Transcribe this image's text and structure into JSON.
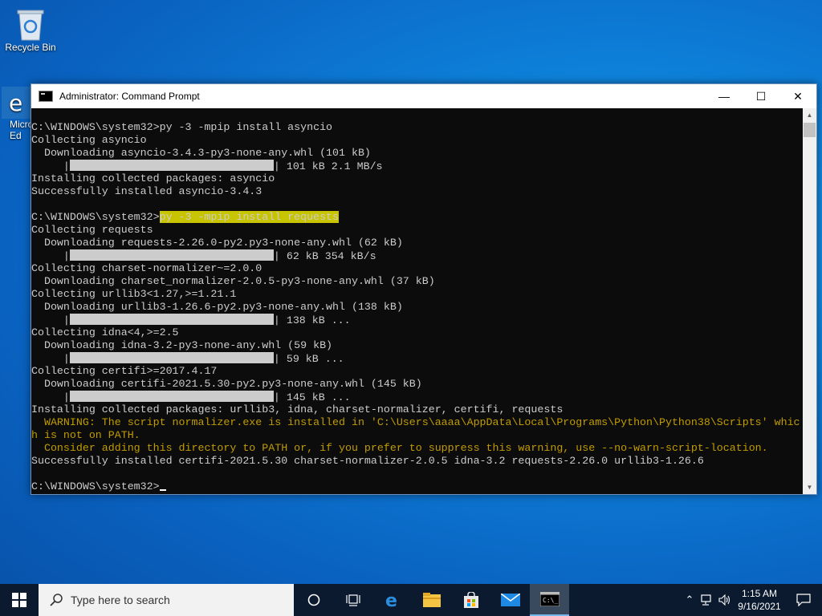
{
  "desktop": {
    "icons": [
      {
        "label": "Recycle Bin"
      },
      {
        "label": "Micro Ed"
      }
    ]
  },
  "window": {
    "title": "Administrator: Command Prompt",
    "buttons": {
      "minimize": "—",
      "maximize": "☐",
      "close": "✕"
    }
  },
  "console": {
    "lines": [
      {
        "text": "C:\\WINDOWS\\system32>py -3 -mpip install asyncio"
      },
      {
        "text": "Collecting asyncio"
      },
      {
        "text": "  Downloading asyncio-3.4.3-py3-none-any.whl (101 kB)"
      },
      {
        "prefix": "     |",
        "bar": true,
        "suffix": "| 101 kB 2.1 MB/s"
      },
      {
        "text": "Installing collected packages: asyncio"
      },
      {
        "text": "Successfully installed asyncio-3.4.3"
      },
      {
        "text": ""
      },
      {
        "prefix": "C:\\WINDOWS\\system32>",
        "highlight": "py -3 -mpip install requests"
      },
      {
        "text": "Collecting requests"
      },
      {
        "text": "  Downloading requests-2.26.0-py2.py3-none-any.whl (62 kB)"
      },
      {
        "prefix": "     |",
        "bar": true,
        "suffix": "| 62 kB 354 kB/s"
      },
      {
        "text": "Collecting charset-normalizer~=2.0.0"
      },
      {
        "text": "  Downloading charset_normalizer-2.0.5-py3-none-any.whl (37 kB)"
      },
      {
        "text": "Collecting urllib3<1.27,>=1.21.1"
      },
      {
        "text": "  Downloading urllib3-1.26.6-py2.py3-none-any.whl (138 kB)"
      },
      {
        "prefix": "     |",
        "bar": true,
        "suffix": "| 138 kB ..."
      },
      {
        "text": "Collecting idna<4,>=2.5"
      },
      {
        "text": "  Downloading idna-3.2-py3-none-any.whl (59 kB)"
      },
      {
        "prefix": "     |",
        "bar": true,
        "suffix": "| 59 kB ..."
      },
      {
        "text": "Collecting certifi>=2017.4.17"
      },
      {
        "text": "  Downloading certifi-2021.5.30-py2.py3-none-any.whl (145 kB)"
      },
      {
        "prefix": "     |",
        "bar": true,
        "suffix": "| 145 kB ..."
      },
      {
        "text": "Installing collected packages: urllib3, idna, charset-normalizer, certifi, requests"
      },
      {
        "text": "  WARNING: The script normalizer.exe is installed in 'C:\\Users\\aaaa\\AppData\\Local\\Programs\\Python\\Python38\\Scripts' whic",
        "warn": true
      },
      {
        "text": "h is not on PATH.",
        "warn": true
      },
      {
        "text": "  Consider adding this directory to PATH or, if you prefer to suppress this warning, use --no-warn-script-location.",
        "warn": true
      },
      {
        "text": "Successfully installed certifi-2021.5.30 charset-normalizer-2.0.5 idna-3.2 requests-2.26.0 urllib3-1.26.6"
      },
      {
        "text": ""
      },
      {
        "prefix": "C:\\WINDOWS\\system32>",
        "cursor": true
      }
    ]
  },
  "taskbar": {
    "search_placeholder": "Type here to search",
    "time": "1:15 AM",
    "date": "9/16/2021"
  },
  "colors": {
    "console_bg": "#0c0c0c",
    "console_fg": "#cccccc",
    "warning": "#c19c00",
    "highlight": "#c8c400"
  }
}
